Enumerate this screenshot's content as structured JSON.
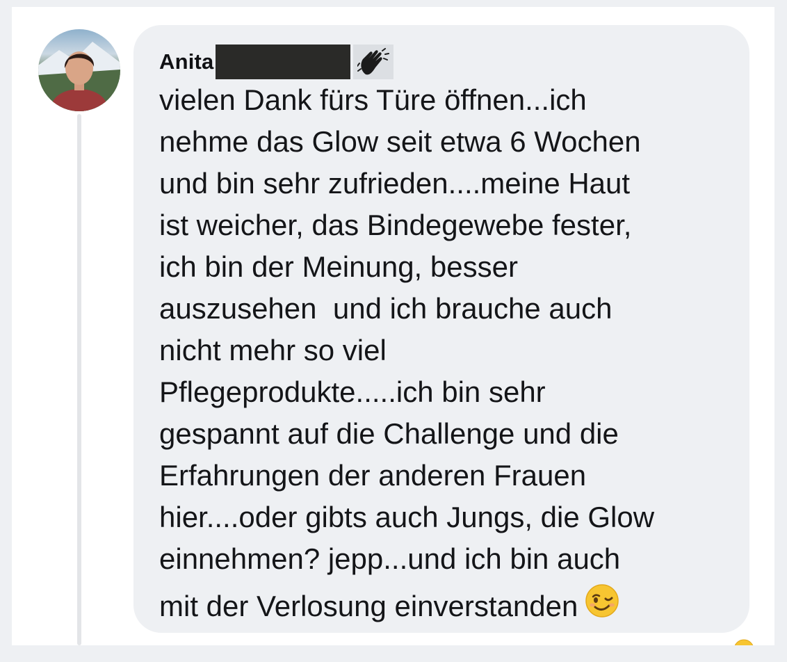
{
  "comment": {
    "author_name": "Anita",
    "author_emoji": "waving-hand-icon",
    "lines": [
      "vielen Dank fürs Türe öffnen...ich",
      "nehme das Glow seit etwa 6 Wochen",
      "und bin sehr zufrieden....meine Haut",
      "ist weicher, das Bindegewebe fester,",
      "ich bin der Meinung, besser",
      "auszusehen  und ich brauche auch",
      "nicht mehr so viel",
      "Pflegeprodukte.....ich bin sehr",
      "gespannt auf die Challenge und die",
      "Erfahrungen der anderen Frauen",
      "hier....oder gibts auch Jungs, die Glow",
      "einnehmen? jepp...und ich bin auch",
      "mit der Verlosung einverstanden"
    ],
    "trailing_emoji": "winking-face-icon",
    "reaction_icon": "reaction-emoji-icon"
  },
  "colors": {
    "bubble": "#eef0f3",
    "text": "#141518",
    "redaction": "#2a2a28",
    "emoji_yellow": "#f7c531"
  }
}
